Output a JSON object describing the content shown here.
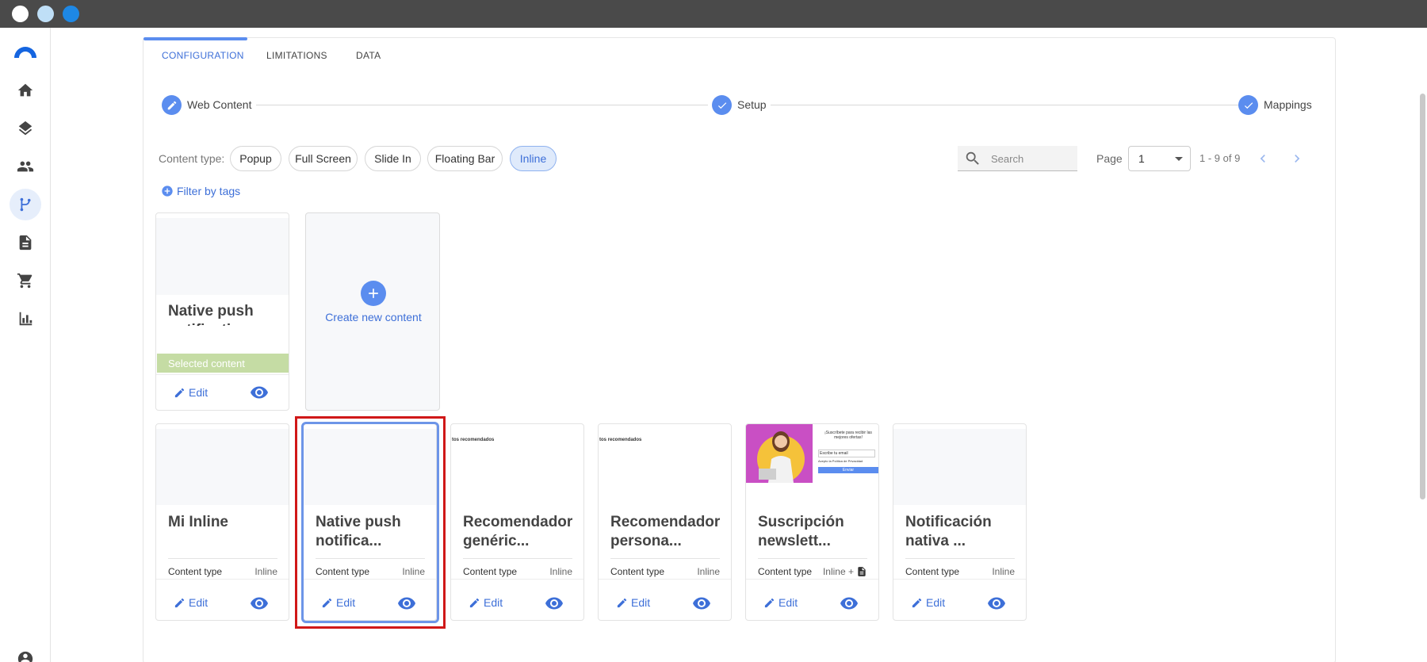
{
  "window": {
    "controls": [
      "close",
      "minimize",
      "maximize"
    ]
  },
  "sidebar": {
    "items": [
      {
        "icon": "home-icon"
      },
      {
        "icon": "layers-icon"
      },
      {
        "icon": "people-icon"
      },
      {
        "icon": "flow-icon",
        "active": true
      },
      {
        "icon": "document-icon"
      },
      {
        "icon": "cart-icon"
      },
      {
        "icon": "bar-chart-icon"
      }
    ],
    "account_icon": "account-circle-icon"
  },
  "tabs": [
    {
      "label": "CONFIGURATION",
      "active": true
    },
    {
      "label": "LIMITATIONS"
    },
    {
      "label": "DATA"
    }
  ],
  "stepper": [
    {
      "label": "Web Content",
      "icon": "pencil-icon"
    },
    {
      "label": "Setup",
      "icon": "check-icon"
    },
    {
      "label": "Mappings",
      "icon": "check-icon"
    }
  ],
  "content_type": {
    "label": "Content type:",
    "options": [
      "Popup",
      "Full Screen",
      "Slide In",
      "Floating Bar",
      "Inline"
    ],
    "selected": "Inline"
  },
  "filter": {
    "label": "Filter by tags"
  },
  "search": {
    "placeholder": "Search"
  },
  "pagination": {
    "label": "Page",
    "page": "1",
    "range": "1 - 9 of 9"
  },
  "selected_card": {
    "title": "Native push notification",
    "selected_label": "Selected content",
    "edit_label": "Edit"
  },
  "create_card": {
    "label": "Create new content"
  },
  "cards": [
    {
      "title": "Mi Inline",
      "type_key": "Content type",
      "type_val": "Inline",
      "edit": "Edit"
    },
    {
      "title": "Native push notifica...",
      "type_key": "Content type",
      "type_val": "Inline",
      "edit": "Edit"
    },
    {
      "title": "Recomendador genéric...",
      "type_key": "Content type",
      "type_val": "Inline",
      "edit": "Edit",
      "thumb_text": "tos recomendados"
    },
    {
      "title": "Recomendador persona...",
      "type_key": "Content type",
      "type_val": "Inline",
      "edit": "Edit",
      "thumb_text": "tos recomendados"
    },
    {
      "title": "Suscripción newslett...",
      "type_key": "Content type",
      "type_val": "Inline +",
      "edit": "Edit",
      "thumb_heading": "¡Suscríbete para recibir las mejores ofertas!",
      "thumb_input": "Escribe tu email",
      "thumb_check": "Acepto la Política de Privacidad",
      "thumb_button": "Enviar"
    },
    {
      "title": "Notificación nativa ...",
      "type_key": "Content type",
      "type_val": "Inline",
      "edit": "Edit"
    }
  ],
  "colors": {
    "accent": "#5b8def",
    "selected_bar": "#c5dca4",
    "highlight": "#d01818"
  }
}
